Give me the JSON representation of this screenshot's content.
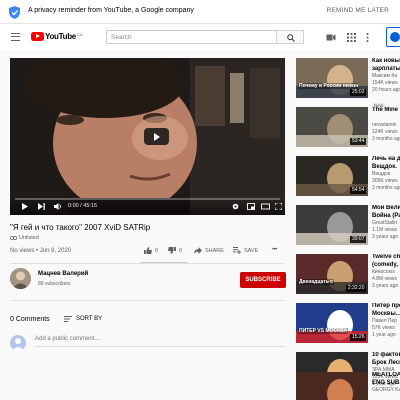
{
  "privacy": {
    "text": "A privacy reminder from YouTube, a Google company",
    "remind": "REMIND ME LATER"
  },
  "masthead": {
    "logo": "YouTube",
    "country": "CA",
    "search_placeholder": "Search"
  },
  "player": {
    "time": "0:00 / 45:15",
    "progress_fraction": 0.0
  },
  "video": {
    "title": "\"Я гей и что такого\" 2007 XviD SATRip",
    "unlisted": "Unlisted",
    "meta": "No views • Jun 9, 2020",
    "likes": "0",
    "dislikes": "0",
    "share": "SHARE",
    "save": "SAVE",
    "more": "•••"
  },
  "channel": {
    "name": "Мацнев Валерий",
    "subs": "89 subscribers",
    "subscribe": "SUBSCRIBE"
  },
  "comments": {
    "count": "0 Comments",
    "sort": "SORT BY",
    "placeholder": "Add a public comment..."
  },
  "recs": [
    {
      "title": "Как новы зарплаты",
      "channel": "Максим Ка",
      "views": "154K views",
      "age": "20 hours ago",
      "duration": "25:02",
      "badge": "New",
      "thumb_text": "Почему в России низкие зарплаты?"
    },
    {
      "title": "The Mine",
      "channel": "nevadamin",
      "views": "124K views",
      "age": "3 months ago",
      "duration": "53:44"
    },
    {
      "title": "Лечь на д Вещдок.",
      "channel": "Вещдок",
      "views": "305K views",
      "age": "3 months ago",
      "duration": "54:54"
    },
    {
      "title": "Мои Вели Война (Рас",
      "channel": "GreatStalin",
      "views": "1.1M views",
      "age": "3 years ago",
      "duration": "39:07"
    },
    {
      "title": "Twelve ch (comedy, d",
      "channel": "Киносоюз",
      "views": "4.8M views",
      "age": "3 years ago",
      "duration": "2:32:20",
      "thumb_text": "Двенадцать с"
    },
    {
      "title": "Питер про Москвы...",
      "channel": "Павел Пер",
      "views": "57K views",
      "age": "1 year ago",
      "duration": "15:26",
      "thumb_text": "ПИТЕР VS МОСКВА"
    },
    {
      "title": "10 фактов Брок Лесн",
      "channel": "ЗРА ММА",
      "views": "125K views",
      "age": "1 year ago",
      "duration": "15:59"
    },
    {
      "title": "MEATLOA ENG SUB.",
      "channel": "GEORGY Ka",
      "views": "",
      "age": "",
      "duration": ""
    }
  ]
}
